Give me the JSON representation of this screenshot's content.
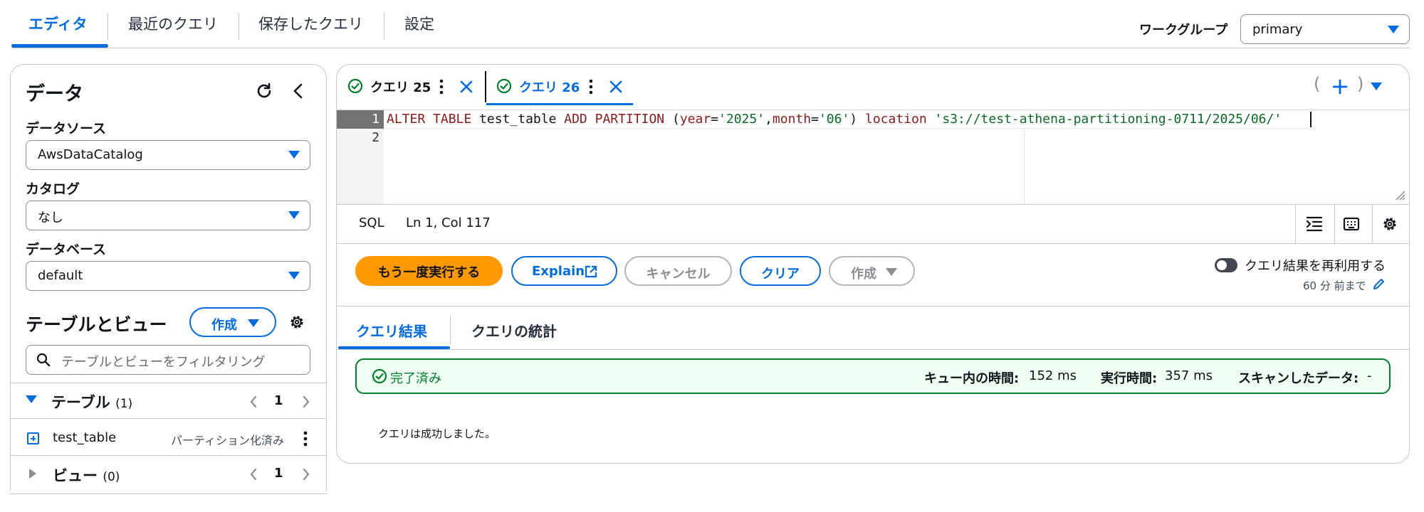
{
  "top_tabs": [
    {
      "label": "エディタ",
      "active": true
    },
    {
      "label": "最近のクエリ"
    },
    {
      "label": "保存したクエリ"
    },
    {
      "label": "設定"
    }
  ],
  "workgroup": {
    "label": "ワークグループ",
    "value": "primary"
  },
  "sidebar": {
    "title": "データ",
    "datasource": {
      "label": "データソース",
      "value": "AwsDataCatalog"
    },
    "catalog": {
      "label": "カタログ",
      "value": "なし"
    },
    "database": {
      "label": "データベース",
      "value": "default"
    },
    "tables_views": {
      "title": "テーブルとビュー",
      "create_label": "作成",
      "filter_placeholder": "テーブルとビューをフィルタリング"
    },
    "tables_section": {
      "label": "テーブル",
      "count": "(1)",
      "page": "1"
    },
    "table_item": {
      "name": "test_table",
      "tag": "パーティション化済み"
    },
    "views_section": {
      "label": "ビュー",
      "count": "(0)",
      "page": "1"
    }
  },
  "editor": {
    "tabs": [
      {
        "label": "クエリ 25",
        "active": false
      },
      {
        "label": "クエリ 26",
        "active": true
      }
    ],
    "lines": [
      {
        "num": "1",
        "tokens": [
          {
            "t": "ALTER",
            "c": "kw"
          },
          {
            "t": " TABLE ",
            "c": "kw"
          },
          {
            "t": "test_table",
            "c": "id"
          },
          {
            "t": " ADD PARTITION ",
            "c": "kw"
          },
          {
            "t": "(",
            "c": "p"
          },
          {
            "t": "year",
            "c": "kw"
          },
          {
            "t": "=",
            "c": "p"
          },
          {
            "t": "'2025'",
            "c": "s"
          },
          {
            "t": ",",
            "c": "p"
          },
          {
            "t": "month",
            "c": "kw"
          },
          {
            "t": "=",
            "c": "p"
          },
          {
            "t": "'06'",
            "c": "s"
          },
          {
            "t": ") ",
            "c": "p"
          },
          {
            "t": "location",
            "c": "kw"
          },
          {
            "t": " ",
            "c": "p"
          },
          {
            "t": "'s3://test-athena-partitioning-0711/2025/06/'",
            "c": "s"
          }
        ]
      },
      {
        "num": "2",
        "tokens": []
      }
    ],
    "status_lang": "SQL",
    "status_pos": "Ln 1, Col 117"
  },
  "actions": {
    "run_again": "もう一度実行する",
    "explain": "Explain",
    "cancel": "キャンセル",
    "clear": "クリア",
    "create": "作成",
    "reuse_label": "クエリ結果を再利用する",
    "reuse_sub": "60 分 前まで"
  },
  "results": {
    "tabs": [
      {
        "label": "クエリ結果",
        "active": true
      },
      {
        "label": "クエリの統計",
        "active": false
      }
    ],
    "status": "完了済み",
    "queue_label": "キュー内の時間:",
    "queue_value": "152 ms",
    "exec_label": "実行時間:",
    "exec_value": "357 ms",
    "scan_label": "スキャンしたデータ:",
    "scan_value": "-",
    "message": "クエリは成功しました。"
  },
  "colors": {
    "accent": "#006ce0",
    "primary_button": "#ff9900",
    "success": "#00802f",
    "success_bg": "#effff1",
    "keyword": "#8b1a1a",
    "string": "#0a6b26"
  }
}
